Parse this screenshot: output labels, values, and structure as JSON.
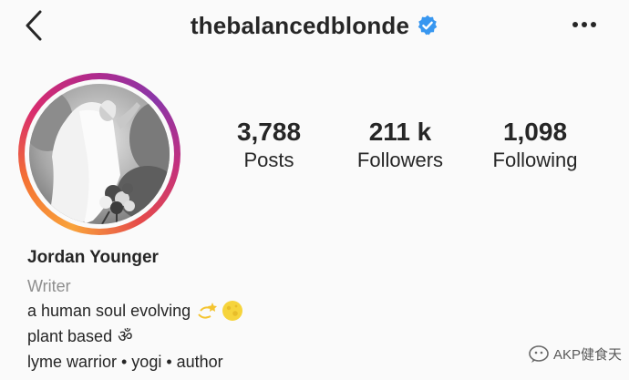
{
  "header": {
    "username": "thebalancedblonde",
    "back_icon": "chevron-left-icon",
    "verified_icon": "verified-badge-icon",
    "more_icon": "more-horizontal-icon"
  },
  "stats": {
    "posts_count": "3,788",
    "posts_label": "Posts",
    "followers_count": "211 k",
    "followers_label": "Followers",
    "following_count": "1,098",
    "following_label": "Following"
  },
  "bio": {
    "full_name": "Jordan Younger",
    "category": "Writer",
    "line1": "a human soul evolving",
    "line2": "plant based",
    "line3": "lyme warrior • yogi • author",
    "line2_symbol": "ॐ"
  },
  "watermark": {
    "text": "AKP健食天"
  },
  "colors": {
    "verified_blue": "#3897f0",
    "text": "#262626",
    "secondary_text": "#8e8e8e",
    "background": "#fafafa"
  }
}
